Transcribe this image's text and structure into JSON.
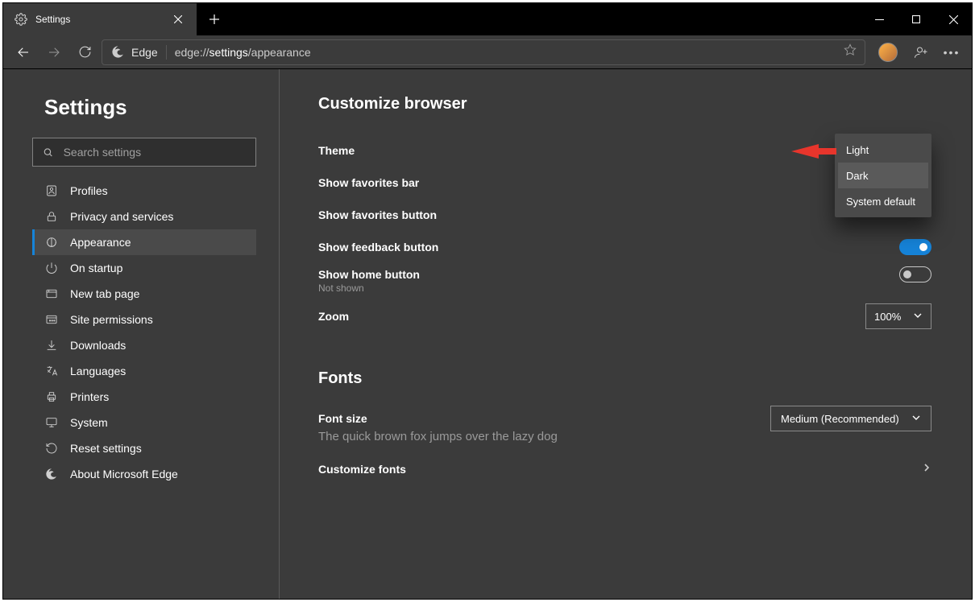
{
  "tab": {
    "title": "Settings"
  },
  "addressbar": {
    "app": "Edge",
    "prefix": "edge://",
    "highlight": "settings",
    "suffix": "/appearance"
  },
  "sidebar": {
    "title": "Settings",
    "search_placeholder": "Search settings",
    "items": [
      {
        "label": "Profiles",
        "icon": "profile"
      },
      {
        "label": "Privacy and services",
        "icon": "lock"
      },
      {
        "label": "Appearance",
        "icon": "appearance",
        "active": true
      },
      {
        "label": "On startup",
        "icon": "power"
      },
      {
        "label": "New tab page",
        "icon": "newtab"
      },
      {
        "label": "Site permissions",
        "icon": "sitepermissions"
      },
      {
        "label": "Downloads",
        "icon": "download"
      },
      {
        "label": "Languages",
        "icon": "language"
      },
      {
        "label": "Printers",
        "icon": "printer"
      },
      {
        "label": "System",
        "icon": "system"
      },
      {
        "label": "Reset settings",
        "icon": "reset"
      },
      {
        "label": "About Microsoft Edge",
        "icon": "edge"
      }
    ]
  },
  "sections": {
    "customize_title": "Customize browser",
    "fonts_title": "Fonts"
  },
  "rows": {
    "theme": {
      "label": "Theme",
      "value": "Dark"
    },
    "favbar": {
      "label": "Show favorites bar"
    },
    "favbtn": {
      "label": "Show favorites button"
    },
    "feedback": {
      "label": "Show feedback button"
    },
    "home": {
      "label": "Show home button",
      "sub": "Not shown"
    },
    "zoom": {
      "label": "Zoom",
      "value": "100%"
    },
    "fontsize": {
      "label": "Font size",
      "value": "Medium (Recommended)",
      "sample": "The quick brown fox jumps over the lazy dog"
    },
    "customfonts": {
      "label": "Customize fonts"
    }
  },
  "theme_dropdown": {
    "options": [
      "Light",
      "Dark",
      "System default"
    ],
    "selected": "Dark"
  }
}
